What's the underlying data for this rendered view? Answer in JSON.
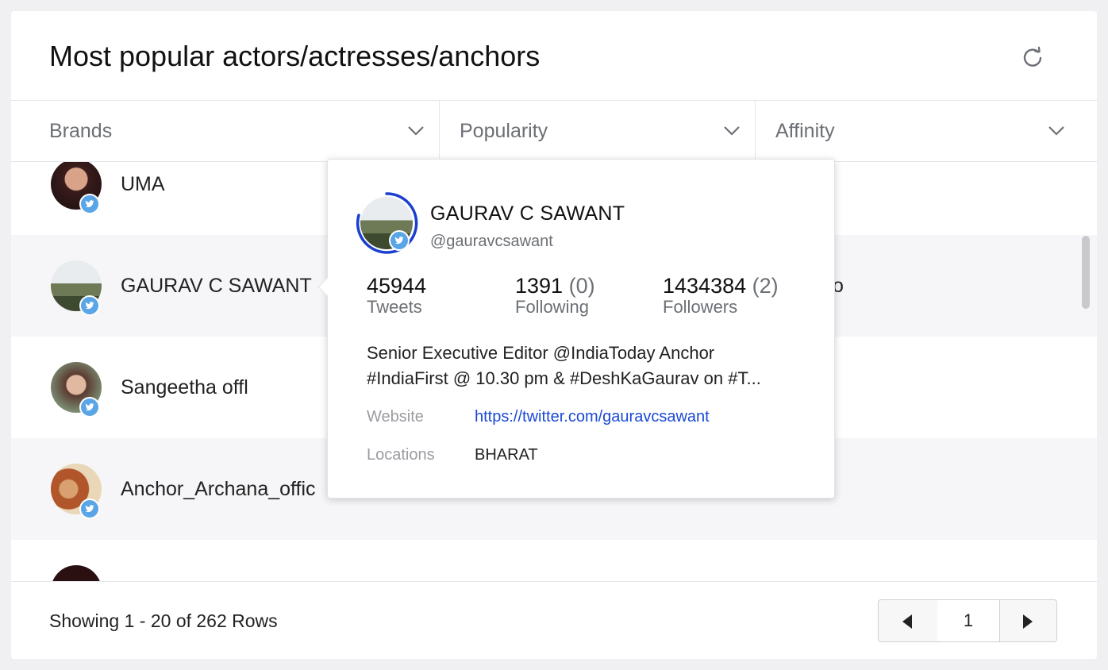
{
  "title": "Most popular actors/actresses/anchors",
  "columns": [
    {
      "label": "Brands"
    },
    {
      "label": "Popularity"
    },
    {
      "label": "Affinity"
    }
  ],
  "rows": [
    {
      "name": "UMA"
    },
    {
      "name": "GAURAV C SAWANT"
    },
    {
      "name": "Sangeetha offl"
    },
    {
      "name": "Anchor_Archana_offic"
    }
  ],
  "partial_row_text": "o",
  "popup": {
    "name": "GAURAV C SAWANT",
    "handle": "@gauravcsawant",
    "stats": [
      {
        "value": "45944",
        "delta": "",
        "label": "Tweets"
      },
      {
        "value": "1391",
        "delta": "(0)",
        "label": "Following"
      },
      {
        "value": "1434384",
        "delta": "(2)",
        "label": "Followers"
      }
    ],
    "bio_line1": "Senior Executive Editor @IndiaToday Anchor",
    "bio_line2": "#IndiaFirst @ 10.30 pm & #DeshKaGaurav on #T...",
    "website_label": "Website",
    "website_value": "https://twitter.com/gauravcsawant",
    "locations_label": "Locations",
    "locations_value": "BHARAT"
  },
  "footer": {
    "showing": "Showing 1 - 20 of 262 Rows",
    "page": "1"
  },
  "colors": {
    "twitter_badge": "#5aa5e6",
    "link": "#1a49d6",
    "ring": "#1a3fcf"
  },
  "icons": [
    "refresh-icon",
    "chevron-down-icon",
    "twitter-icon",
    "prev-page-icon",
    "next-page-icon"
  ]
}
